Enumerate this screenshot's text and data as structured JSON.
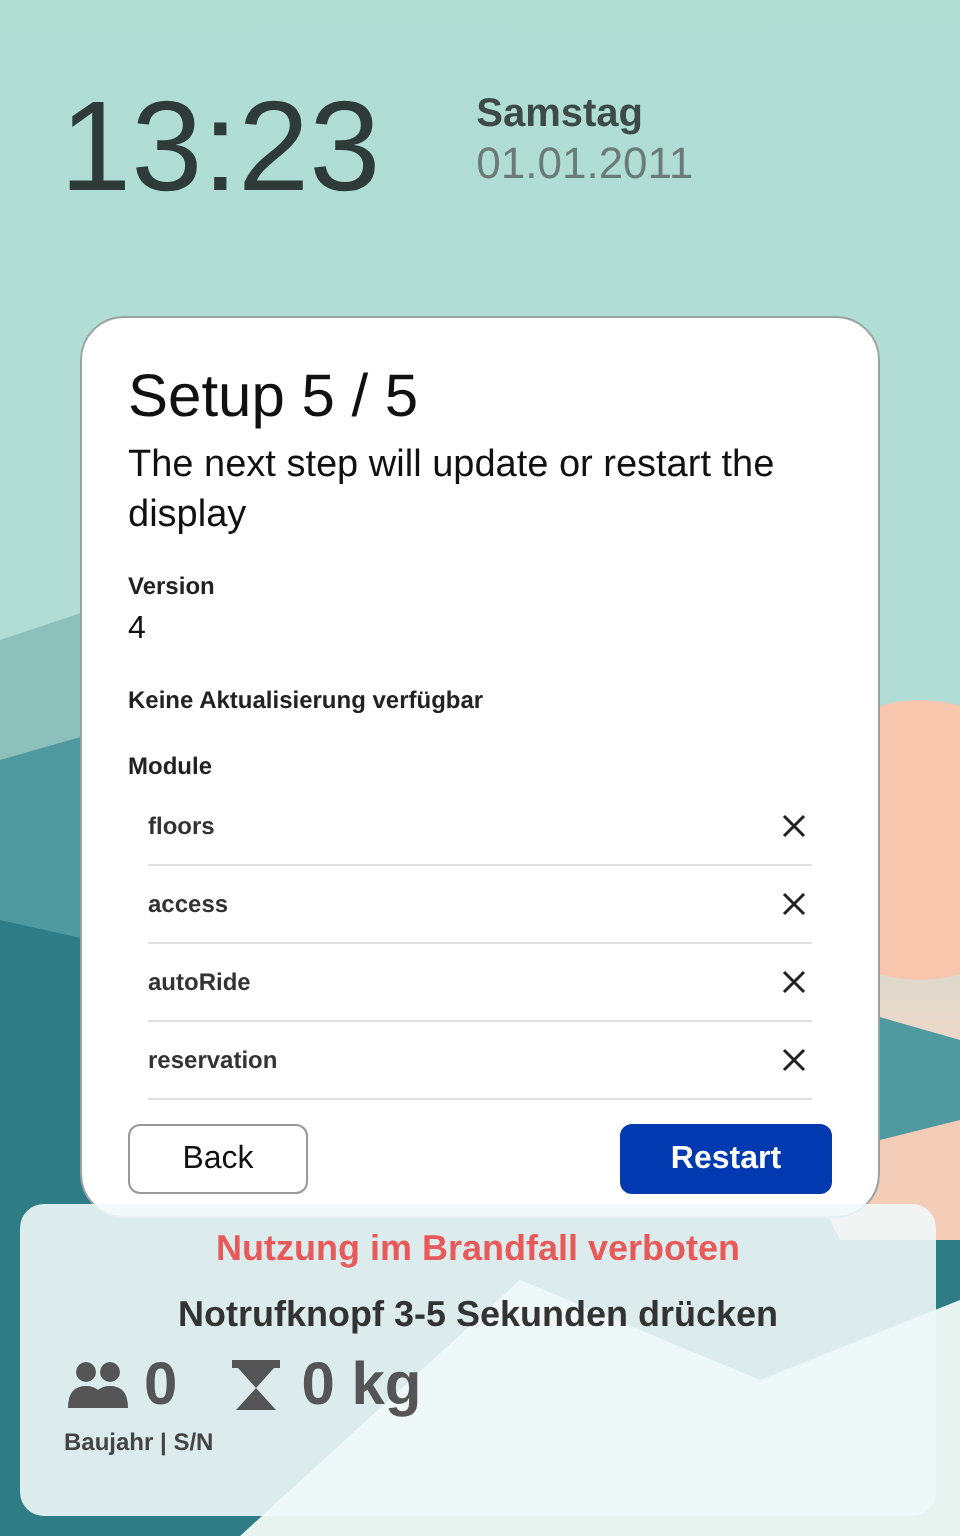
{
  "clock": {
    "time": "13:23",
    "weekday": "Samstag",
    "date": "01.01.2011"
  },
  "dialog": {
    "title": "Setup 5 / 5",
    "subtitle": "The next step will update or restart the display",
    "fields": [
      {
        "label": "Version",
        "value": "4"
      }
    ],
    "status": "Keine Aktualisierung verfügbar",
    "modules_label": "Module",
    "modules": [
      {
        "name": "floors"
      },
      {
        "name": "access"
      },
      {
        "name": "autoRide"
      },
      {
        "name": "reservation"
      }
    ],
    "buttons": [
      {
        "label": "Back",
        "kind": "secondary"
      },
      {
        "label": "Restart",
        "kind": "primary"
      }
    ]
  },
  "info_panel": {
    "warning": "Nutzung im Brandfall verboten",
    "instruction": "Notrufknopf 3-5 Sekunden drücken",
    "stats": [
      {
        "kind": "persons",
        "value": "0"
      },
      {
        "kind": "load",
        "value": "0 kg"
      }
    ],
    "footer": "Baujahr | S/N"
  }
}
